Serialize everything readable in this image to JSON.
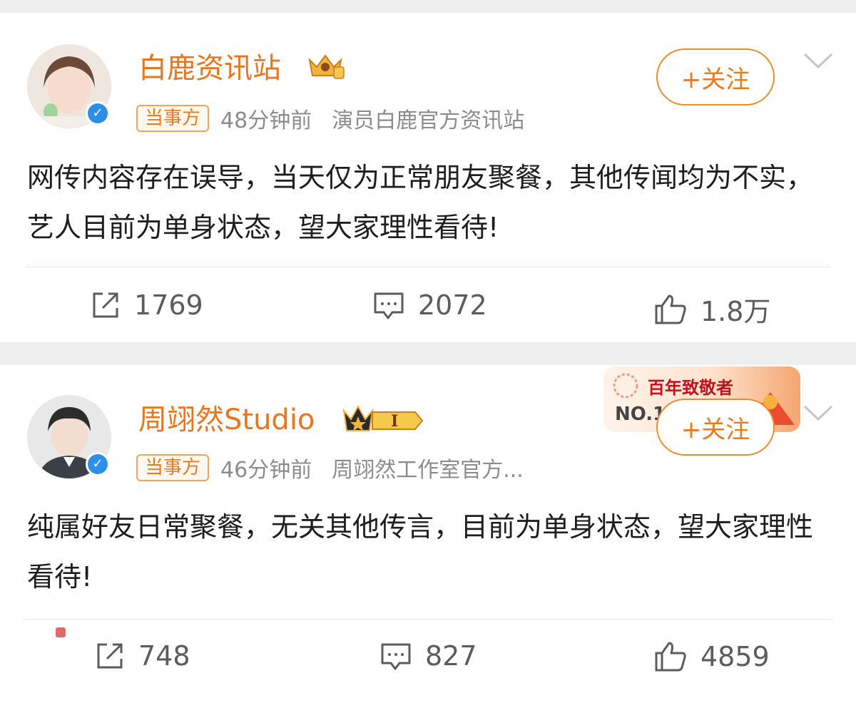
{
  "posts": [
    {
      "username": "白鹿资讯站",
      "role_tag": "当事方",
      "time": "48分钟前",
      "source": "演员白鹿官方资讯站",
      "follow_label": "+关注",
      "text": "网传内容存在误导，当天仅为正常朋友聚餐，其他传闻均为不实，艺人目前为单身状态，望大家理性看待!",
      "reposts": "1769",
      "comments": "2072",
      "likes": "1.8万",
      "badge_icon": "gold-crown-badge-icon"
    },
    {
      "username": "周翊然Studio",
      "role_tag": "当事方",
      "time": "46分钟前",
      "source": "周翊然工作室官方...",
      "follow_label": "+关注",
      "text": "纯属好友日常聚餐，无关其他传言，目前为单身状态，望大家理性看待!",
      "reposts": "748",
      "comments": "827",
      "likes": "4859",
      "badge_icon": "crown-level-I-badge-icon"
    }
  ],
  "promo": {
    "title": "百年致敬者",
    "rank": "NO.1"
  },
  "colors": {
    "accent_orange": "#e9761f",
    "verify_blue": "#2b8fe6",
    "text_gray": "#8c8c8c"
  }
}
